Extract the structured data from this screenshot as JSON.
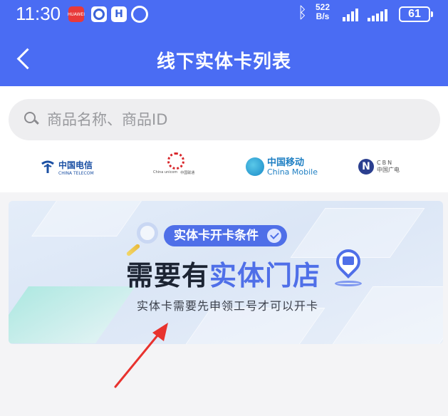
{
  "status_bar": {
    "time": "11:30",
    "net_speed_value": "522",
    "net_speed_unit": "B/s",
    "battery": "61",
    "icons": [
      "huawei-app-icon",
      "camera-app-icon",
      "h-app-icon",
      "alarm-icon",
      "bluetooth-icon",
      "signal-icon",
      "signal-hd-icon",
      "battery-icon"
    ]
  },
  "header": {
    "title": "线下实体卡列表",
    "background_color": "#4a6cf3"
  },
  "search": {
    "placeholder": "商品名称、商品ID",
    "value": ""
  },
  "operators": [
    {
      "name": "中国电信",
      "sub": "CHINA TELECOM",
      "icon": "china-telecom-logo"
    },
    {
      "name": "中国联通",
      "sub": "China unicom",
      "icon": "china-unicom-logo"
    },
    {
      "name": "中国移动",
      "sub": "China Mobile",
      "icon": "china-mobile-logo"
    },
    {
      "name": "CBN",
      "sub": "中国广电",
      "icon": "china-broadnet-logo"
    }
  ],
  "banner": {
    "badge": "实体卡开卡条件",
    "headline_plain": "需要有",
    "headline_highlight": "实体门店",
    "subtitle": "实体卡需要先申领工号才可以开卡",
    "accent_color": "#4f6fe8"
  },
  "annotation": {
    "arrow_color": "#e8322e"
  }
}
